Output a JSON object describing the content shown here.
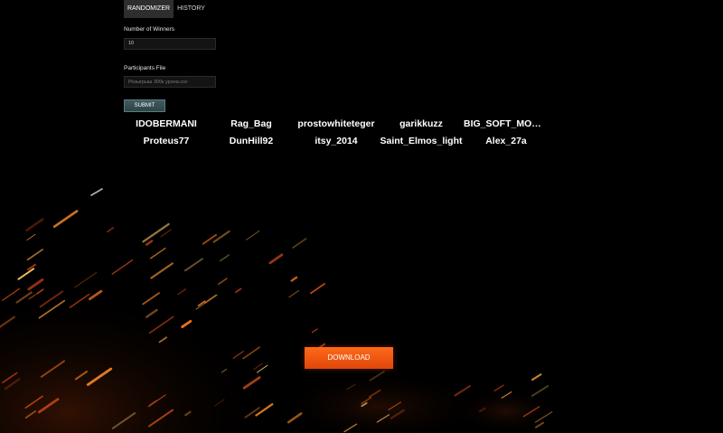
{
  "tabs": [
    {
      "label": "RANDOMIZER",
      "active": true
    },
    {
      "label": "HISTORY",
      "active": false
    }
  ],
  "form": {
    "winners_label": "Number of Winners",
    "winners_value": "10",
    "file_label": "Participants File",
    "file_placeholder": "Розыгрыш 300к урона.csv",
    "submit_label": "SUBMIT"
  },
  "winners": [
    "IDOBERMANI",
    "Rag_Bag",
    "prostowhiteteger",
    "garikkuzz",
    "BIG_SOFT_MOMM...",
    "Proteus77",
    "DunHill92",
    "itsy_2014",
    "Saint_Elmos_light",
    "Alex_27a"
  ],
  "download_label": "DOWNLOAD",
  "colors": {
    "background": "#000000",
    "accent_orange": "#ff6a1a",
    "submit_bg": "#3f5b60",
    "active_tab_bg": "#2e2e2e"
  }
}
